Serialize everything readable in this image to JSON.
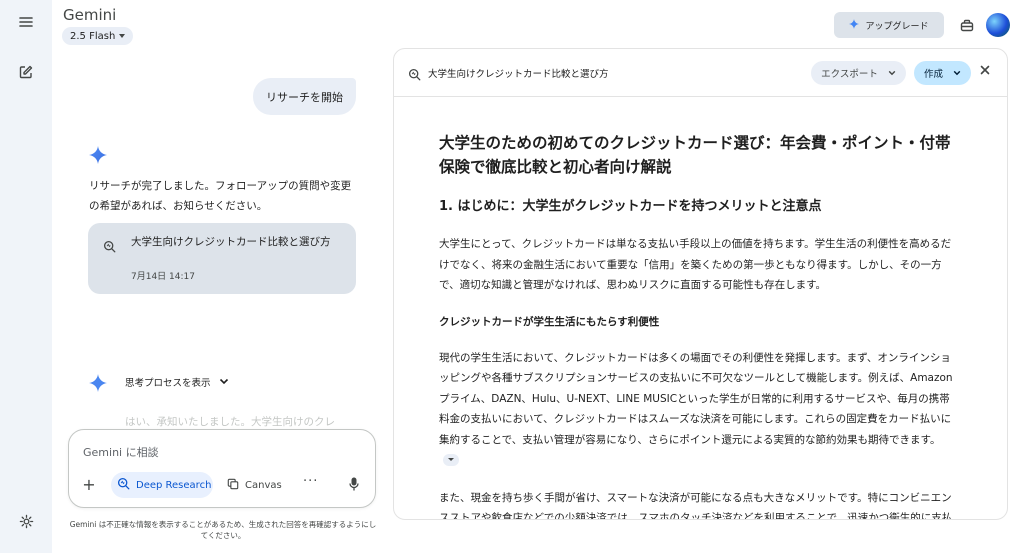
{
  "app": {
    "name": "Gemini",
    "model": "2.5 Flash"
  },
  "header": {
    "upgrade_label": "アップグレード"
  },
  "chat": {
    "user_message": "リサーチを開始",
    "reply": "リサーチが完了しました。フォローアップの質問や変更の希望があれば、お知らせください。",
    "file_card": {
      "title": "大学生向けクレジットカード比較と選び方",
      "date": "7月14日 14:17"
    },
    "thinking_label": "思考プロセスを表示",
    "faded_text": "はい、承知いたしました。大学生向けのクレ"
  },
  "composer": {
    "placeholder": "Gemini に相談",
    "deep_research_label": "Deep Research",
    "canvas_label": "Canvas",
    "more_label": "···",
    "disclaimer": "Gemini は不正確な情報を表示することがあるため、生成された回答を再確認するようにしてください。"
  },
  "panel": {
    "title": "大学生向けクレジットカード比較と選び方",
    "export_label": "エクスポート",
    "create_label": "作成",
    "document": {
      "title": "大学生のための初めてのクレジットカード選び：年会費・ポイント・付帯保険で徹底比較と初心者向け解説",
      "section_heading": "1. はじめに：大学生がクレジットカードを持つメリットと注意点",
      "paragraph1": "大学生にとって、クレジットカードは単なる支払い手段以上の価値を持ちます。学生生活の利便性を高めるだけでなく、将来の金融生活において重要な「信用」を築くための第一歩ともなり得ます。しかし、その一方で、適切な知識と管理がなければ、思わぬリスクに直面する可能性も存在します。",
      "subheading": "クレジットカードが学生生活にもたらす利便性",
      "paragraph2": "現代の学生生活において、クレジットカードは多くの場面でその利便性を発揮します。まず、オンラインショッピングや各種サブスクリプションサービスの支払いに不可欠なツールとして機能します。例えば、Amazonプライム、DAZN、Hulu、U-NEXT、LINE MUSICといった学生が日常的に利用するサービスや、毎月の携帯料金の支払いにおいて、クレジットカードはスムーズな決済を可能にします。これらの固定費をカード払いに集約することで、支払い管理が容易になり、さらにポイント還元による実質的な節約効果も期待できます。",
      "paragraph3": "また、現金を持ち歩く手間が省け、スマートな決済が可能になる点も大きなメリットです。特にコンビニエンスストアや飲食店などでの少額決済では、スマホのタッチ決済などを利用することで、迅速かつ衛生的に支払いを完了できます。これにより、財布の中の小銭を気にすることなく、スムーズな"
    }
  },
  "colors": {
    "accent": "#0b57d0",
    "sidebar_bg": "#f0f4f9",
    "chip_blue": "#c2e7ff"
  }
}
